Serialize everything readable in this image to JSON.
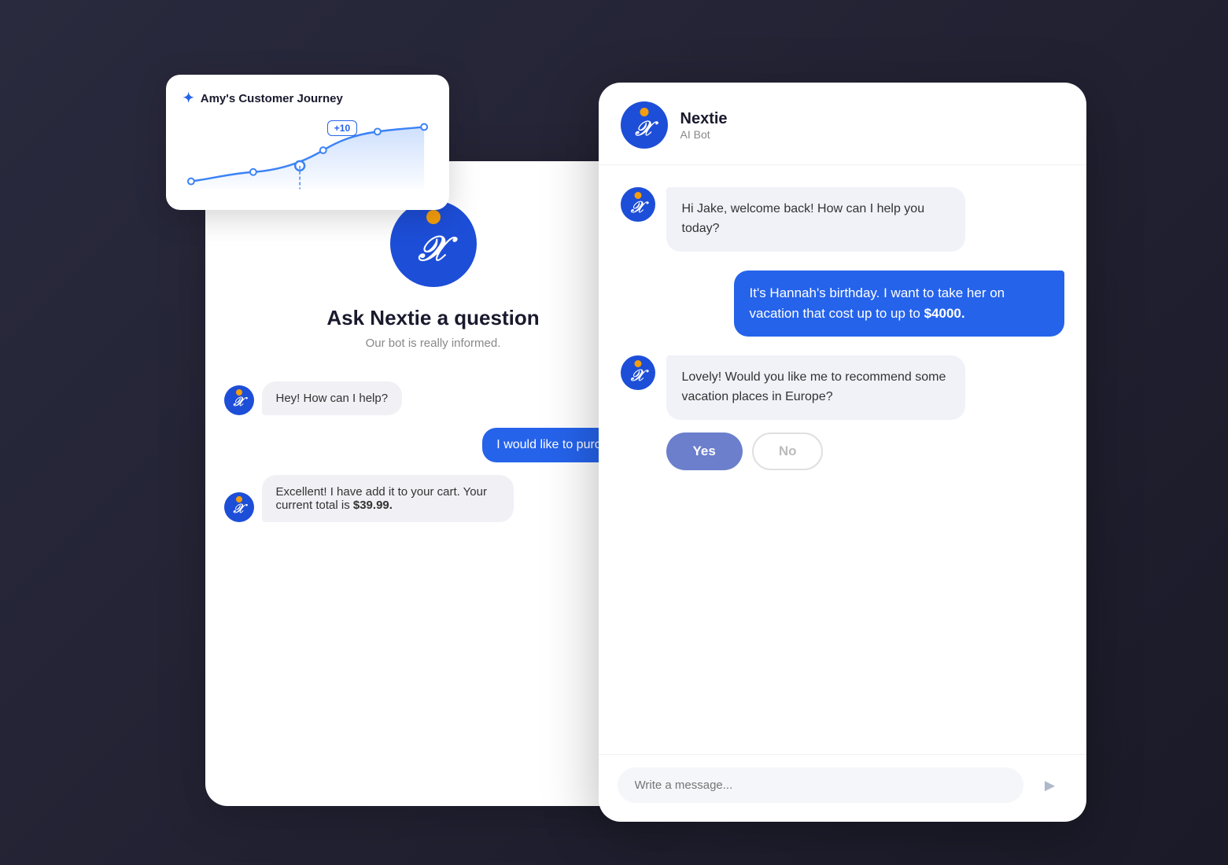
{
  "scene": {
    "journey_card": {
      "title": "Amy's Customer Journey",
      "badge": "+10"
    },
    "back_chat": {
      "bot_name": "Ask Nextie a question",
      "bot_sub": "Our bot is really informed.",
      "messages": [
        {
          "role": "bot",
          "text": "Hey! How can I help?"
        },
        {
          "role": "user",
          "text": "I would like to purchase"
        },
        {
          "role": "bot",
          "text": "Excellent! I have add it to your cart. Your current total is $39.99."
        }
      ]
    },
    "front_chat": {
      "header": {
        "name": "Nextie",
        "role": "AI Bot"
      },
      "messages": [
        {
          "role": "bot",
          "text": "Hi Jake, welcome back! How can I help you today?"
        },
        {
          "role": "user",
          "text": "It's Hannah's birthday. I want to take her on vacation that cost up to up to $4000."
        },
        {
          "role": "bot",
          "text": "Lovely! Would you like me to recommend some vacation places in Europe?"
        }
      ],
      "options": {
        "yes": "Yes",
        "no": "No"
      },
      "input_placeholder": "Write a message..."
    }
  }
}
